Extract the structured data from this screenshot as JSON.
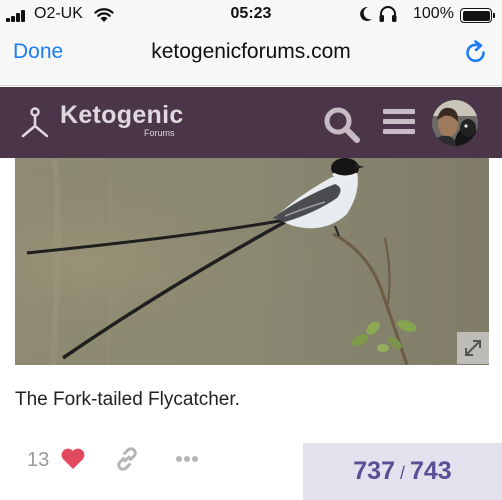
{
  "status_bar": {
    "carrier": "O2-UK",
    "time": "05:23",
    "battery_percent": "100%",
    "battery_level": 1.0
  },
  "browser": {
    "done_label": "Done",
    "url": "ketogenicforums.com"
  },
  "forum_header": {
    "title": "Ketogenic",
    "subtitle": "Forums"
  },
  "post": {
    "caption": "The Fork-tailed Flycatcher.",
    "like_count": "13"
  },
  "progress": {
    "current": "737",
    "separator": "/",
    "total": "743"
  },
  "colors": {
    "header_bg": "#4a3549",
    "link_blue": "#1a7ef2",
    "heart_red": "#e0495e",
    "progress_bg": "#e4e0ee",
    "progress_text": "#5a4e95"
  },
  "icons": [
    "signal-bars-icon",
    "wifi-icon",
    "moon-icon",
    "headphones-icon",
    "battery-icon",
    "reload-icon",
    "ketogenic-logo-icon",
    "search-icon",
    "hamburger-menu-icon",
    "expand-icon",
    "heart-icon",
    "link-icon",
    "ellipsis-icon"
  ]
}
